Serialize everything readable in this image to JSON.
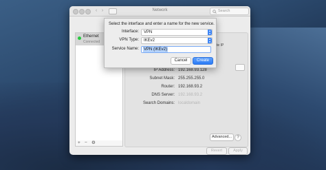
{
  "window": {
    "title": "Network",
    "search_placeholder": "Search"
  },
  "sidebar": {
    "services": [
      {
        "name": "Ethernet",
        "status": "Connected",
        "status_color": "#28c840"
      }
    ],
    "add_label": "+",
    "remove_label": "−",
    "gear_label": "⚙"
  },
  "details": {
    "partial_ip_text": "te IP",
    "rows": [
      {
        "label": "IP Address:",
        "value": "192.168.93.128"
      },
      {
        "label": "Subnet Mask:",
        "value": "255.255.255.0"
      },
      {
        "label": "Router:",
        "value": "192.168.93.2"
      },
      {
        "label": "DNS Server:",
        "value": "192.168.93.2"
      },
      {
        "label": "Search Domains:",
        "value": "localdomain"
      }
    ],
    "advanced_label": "Advanced...",
    "help_label": "?",
    "revert_label": "Revert",
    "apply_label": "Apply"
  },
  "sheet": {
    "message": "Select the interface and enter a name for the new service.",
    "interface_label": "Interface:",
    "interface_value": "VPN",
    "vpn_type_label": "VPN Type:",
    "vpn_type_value": "IKEv2",
    "service_name_label": "Service Name:",
    "service_name_value": "VPN (IKEv2)",
    "cancel_label": "Cancel",
    "create_label": "Create",
    "accent_color": "#3f86f6"
  }
}
